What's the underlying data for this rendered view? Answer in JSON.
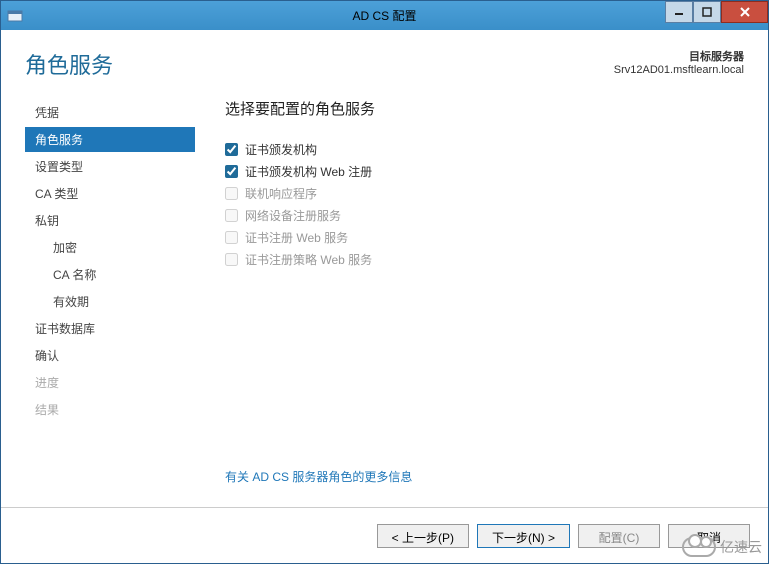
{
  "titlebar": {
    "title": "AD CS 配置"
  },
  "header": {
    "page_title": "角色服务",
    "server_label": "目标服务器",
    "server_name": "Srv12AD01.msftlearn.local"
  },
  "sidebar": {
    "items": [
      {
        "label": "凭据",
        "active": false,
        "indent": false,
        "disabled": false
      },
      {
        "label": "角色服务",
        "active": true,
        "indent": false,
        "disabled": false
      },
      {
        "label": "设置类型",
        "active": false,
        "indent": false,
        "disabled": false
      },
      {
        "label": "CA 类型",
        "active": false,
        "indent": false,
        "disabled": false
      },
      {
        "label": "私钥",
        "active": false,
        "indent": false,
        "disabled": false
      },
      {
        "label": "加密",
        "active": false,
        "indent": true,
        "disabled": false
      },
      {
        "label": "CA 名称",
        "active": false,
        "indent": true,
        "disabled": false
      },
      {
        "label": "有效期",
        "active": false,
        "indent": true,
        "disabled": false
      },
      {
        "label": "证书数据库",
        "active": false,
        "indent": false,
        "disabled": false
      },
      {
        "label": "确认",
        "active": false,
        "indent": false,
        "disabled": false
      },
      {
        "label": "进度",
        "active": false,
        "indent": false,
        "disabled": true
      },
      {
        "label": "结果",
        "active": false,
        "indent": false,
        "disabled": true
      }
    ]
  },
  "main": {
    "section_title": "选择要配置的角色服务",
    "options": [
      {
        "label": "证书颁发机构",
        "checked": true,
        "enabled": true
      },
      {
        "label": "证书颁发机构 Web 注册",
        "checked": true,
        "enabled": true
      },
      {
        "label": "联机响应程序",
        "checked": false,
        "enabled": false
      },
      {
        "label": "网络设备注册服务",
        "checked": false,
        "enabled": false
      },
      {
        "label": "证书注册 Web 服务",
        "checked": false,
        "enabled": false
      },
      {
        "label": "证书注册策略 Web 服务",
        "checked": false,
        "enabled": false
      }
    ],
    "more_link": "有关 AD CS 服务器角色的更多信息"
  },
  "footer": {
    "prev": "< 上一步(P)",
    "next": "下一步(N) >",
    "configure": "配置(C)",
    "cancel": "取消"
  },
  "watermark": "亿速云"
}
